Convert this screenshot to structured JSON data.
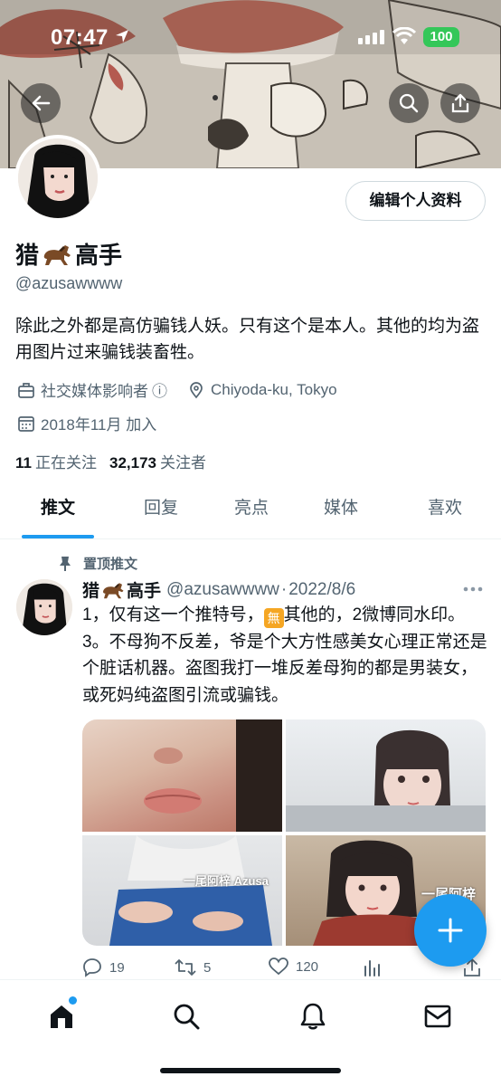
{
  "status_bar": {
    "time": "07:47",
    "battery": "100",
    "battery_color": "#34c759"
  },
  "header": {
    "back_icon": "arrow-left-icon",
    "search_icon": "search-icon",
    "share_icon": "share-icon"
  },
  "profile": {
    "edit_button_label": "编辑个人资料",
    "name_prefix": "猎",
    "name_emoji": "horse-emoji",
    "name_suffix": "高手",
    "handle": "@azusawwww",
    "bio": "除此之外都是高仿骗钱人妖。只有这个是本人。其他的均为盗用图片过来骗钱装畜牲。",
    "category": "社交媒体影响者",
    "category_info_glyph": "ⓘ",
    "location": "Chiyoda-ku, Tokyo",
    "joined": "2018年11月 加入",
    "following_count": "11",
    "following_label": "正在关注",
    "followers_count": "32,173",
    "followers_label": "关注者"
  },
  "tabs": [
    {
      "label": "推文",
      "active": true
    },
    {
      "label": "回复",
      "active": false
    },
    {
      "label": "亮点",
      "active": false
    },
    {
      "label": "媒体",
      "active": false
    },
    {
      "label": "喜欢",
      "active": false
    }
  ],
  "pinned_tweet": {
    "pin_label": "置顶推文",
    "name_prefix": "猎",
    "name_suffix": "高手",
    "handle": "@azusawwww",
    "separator": "·",
    "date": "2022/8/6",
    "text_part1": "1，仅有这一个推特号，",
    "badge_glyph": "無",
    "text_part2": "其他的，2微博同水印。3。不母狗不反差，爷是个大方性感美女心理正常还是个脏话机器。盗图我打一堆反差母狗的都是男装女，或死妈纯盗图引流或骗钱。",
    "watermark_1": "一尾阿梓 Azusa",
    "watermark_2": "一尾阿梓",
    "reply_count": "19",
    "retweet_count": "5",
    "like_count": "120"
  },
  "accent_color": "#1d9bf0",
  "bottom_nav": [
    "home-icon",
    "search-icon",
    "bell-icon",
    "mail-icon"
  ]
}
